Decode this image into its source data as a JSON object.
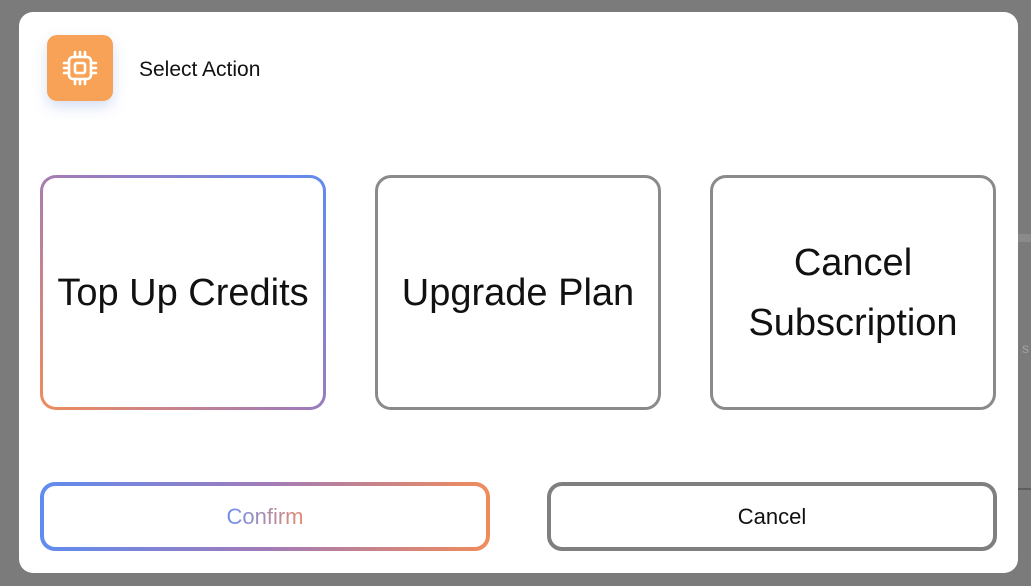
{
  "dialog": {
    "title": "Select Action",
    "icon": "cpu-chip-icon",
    "accent_color": "#f8a257"
  },
  "options": [
    {
      "label": "Top Up Credits",
      "selected": true
    },
    {
      "label": "Upgrade Plan",
      "selected": false
    },
    {
      "label": "Cancel Subscription",
      "selected": false
    }
  ],
  "footer": {
    "confirm_label": "Confirm",
    "cancel_label": "Cancel"
  },
  "colors": {
    "selection_gradient": [
      "#f08c5b",
      "#a07bb8",
      "#5f8cf0"
    ],
    "neutral_border": "#8a8a8a"
  }
}
